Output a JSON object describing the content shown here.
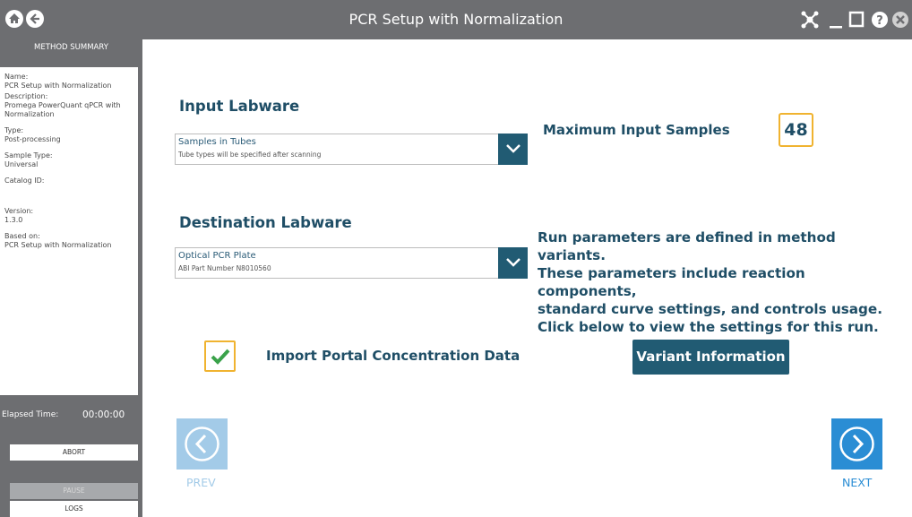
{
  "window": {
    "title": "PCR Setup with Normalization",
    "home_icon": "home-icon",
    "back_icon": "back-icon",
    "network_icon": "network-icon",
    "minimize_icon": "minimize-icon",
    "maximize_icon": "maximize-icon",
    "help_icon": "help-icon",
    "close_icon": "close-icon"
  },
  "sidebar": {
    "header": "METHOD SUMMARY",
    "fields": [
      {
        "label": "Name:",
        "value": "PCR Setup with Normalization"
      },
      {
        "label": "Description:",
        "value": "Promega PowerQuant qPCR with Normalization"
      },
      {
        "label": "Type:",
        "value": "Post-processing"
      },
      {
        "label": "Sample Type:",
        "value": "Universal"
      },
      {
        "label": "Catalog ID:",
        "value": ""
      },
      {
        "label": "Version:",
        "value": "1.3.0"
      },
      {
        "label": "Based on:",
        "value": "PCR Setup with Normalization"
      }
    ],
    "elapsed_label": "Elapsed Time:",
    "elapsed_value": "00:00:00",
    "abort_label": "ABORT",
    "pause_label": "PAUSE",
    "logs_label": "LOGS"
  },
  "input_labware": {
    "title": "Input Labware",
    "selected": "Samples in Tubes",
    "subtext": "Tube types will be specified after scanning"
  },
  "max_samples": {
    "label": "Maximum Input Samples",
    "value": "48"
  },
  "destination_labware": {
    "title": "Destination Labware",
    "selected": "Optical PCR Plate",
    "subtext": "ABI Part Number N8010560"
  },
  "run_parameters": {
    "lines": [
      "Run parameters are defined in method variants.",
      "These parameters include reaction components,",
      "standard curve settings, and controls usage.",
      "Click below to view the settings for this run."
    ]
  },
  "import_portal": {
    "label": "Import Portal Concentration Data",
    "checked": true
  },
  "variant_button": "Variant Information",
  "nav": {
    "prev_label": "PREV",
    "next_label": "NEXT"
  },
  "colors": {
    "brand_dark": "#215b73",
    "accent": "#f0b330",
    "nav_active": "#2a8dd4",
    "nav_disabled": "#a3cbe8",
    "chrome_gray": "#6d6e71"
  }
}
